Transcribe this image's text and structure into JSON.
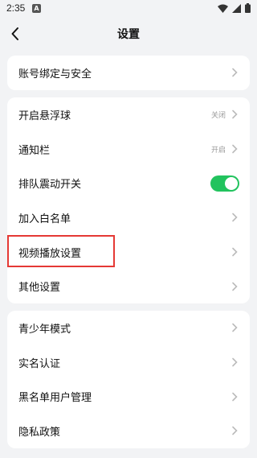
{
  "status_bar": {
    "time": "2:35",
    "app_icon_letter": "A"
  },
  "header": {
    "title": "设置"
  },
  "sections": [
    {
      "items": [
        {
          "label": "账号绑定与安全",
          "value": ""
        }
      ]
    },
    {
      "items": [
        {
          "label": "开启悬浮球",
          "value": "关闭"
        },
        {
          "label": "通知栏",
          "value": "开启"
        },
        {
          "label": "排队震动开关",
          "value": "",
          "toggle_on": true
        },
        {
          "label": "加入白名单",
          "value": ""
        },
        {
          "label": "视频播放设置",
          "value": ""
        },
        {
          "label": "其他设置",
          "value": ""
        }
      ]
    },
    {
      "items": [
        {
          "label": "青少年模式",
          "value": ""
        },
        {
          "label": "实名认证",
          "value": ""
        },
        {
          "label": "黑名单用户管理",
          "value": ""
        },
        {
          "label": "隐私政策",
          "value": ""
        }
      ]
    }
  ],
  "colors": {
    "background": "#f2f3f5",
    "toggle_on": "#22c35e",
    "highlight": "#e53935"
  }
}
